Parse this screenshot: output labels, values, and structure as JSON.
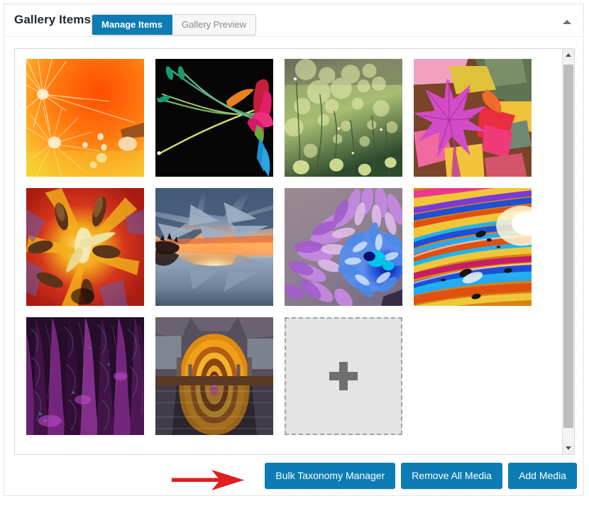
{
  "panel": {
    "title": "Gallery Items",
    "collapse_icon": "triangle-up-icon"
  },
  "tabs": [
    {
      "label": "Manage Items",
      "active": true
    },
    {
      "label": "Gallery Preview",
      "active": false
    }
  ],
  "gallery": {
    "items": [
      {
        "name": "orange-dandelion-dew",
        "alt": "Orange dandelion seed head with water droplets"
      },
      {
        "name": "lily-on-black",
        "alt": "Colorful lily flower with long stamens on black background"
      },
      {
        "name": "green-grass-bokeh",
        "alt": "Green grass with golden bokeh lights"
      },
      {
        "name": "pink-maple-leaves",
        "alt": "Pink maple leaf over autumn foliage"
      },
      {
        "name": "red-tulip-stamens",
        "alt": "Close up of red tulip interior with stamens"
      },
      {
        "name": "sunset-lake-clouds",
        "alt": "Dramatic sunset over lake with radiating clouds"
      },
      {
        "name": "purple-blue-chrysanthemum",
        "alt": "Purple and blue chrysanthemum bloom"
      },
      {
        "name": "rainbow-oil-swirl",
        "alt": "Abstract rainbow oil slick swirl"
      },
      {
        "name": "purple-feathers",
        "alt": "Purple feather texture"
      },
      {
        "name": "orange-vaulted-bath",
        "alt": "Underground vaulted arches reflected in water"
      }
    ],
    "add_tile": {
      "name": "add-media-tile",
      "icon": "plus-icon"
    },
    "scrollbar": {
      "up_icon": "scroll-up-arrow-icon",
      "down_icon": "scroll-down-arrow-icon"
    }
  },
  "footer": {
    "buttons": [
      {
        "label": "Bulk Taxonomy Manager",
        "name": "bulk-taxonomy-manager-button"
      },
      {
        "label": "Remove All Media",
        "name": "remove-all-media-button"
      },
      {
        "label": "Add Media",
        "name": "add-media-button"
      }
    ]
  },
  "annotation": {
    "arrow": "red-arrow-pointing-right",
    "color": "#e02020"
  },
  "colors": {
    "accent": "#0d7cb5",
    "panel_border": "#c9c9c9",
    "container_border": "#d8d8d8",
    "text": "#23282d",
    "tab_inactive_text": "#8a8a8a"
  }
}
